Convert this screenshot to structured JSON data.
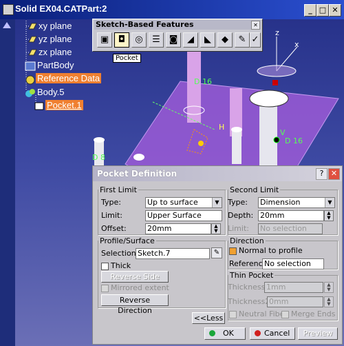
{
  "window": {
    "title": "Solid EX04.CATPart:2",
    "btn_min": "_",
    "btn_max": "□",
    "btn_close": "✕"
  },
  "tree": {
    "items": [
      {
        "label": "xy plane"
      },
      {
        "label": "yz plane"
      },
      {
        "label": "zx plane"
      },
      {
        "label": "PartBody"
      },
      {
        "label": "Reference Data"
      },
      {
        "label": "Body.5"
      },
      {
        "label": "Pocket.1"
      }
    ]
  },
  "toolbar": {
    "title": "Sketch-Based Features",
    "tooltip": "Pocket",
    "close": "✕"
  },
  "viewport": {
    "label_d16_a": "D 16",
    "label_d16_b": "D 16",
    "label_d8": "D 8",
    "label_h": "H",
    "label_v": "V",
    "label_z": "z",
    "label_x": "x"
  },
  "dialog": {
    "title": "Pocket Definition",
    "help": "?",
    "close": "✕",
    "first_limit": {
      "legend": "First Limit",
      "type_label": "Type:",
      "type_value": "Up to surface",
      "limit_label": "Limit:",
      "limit_value": "Upper Surface",
      "offset_label": "Offset:",
      "offset_value": "20mm"
    },
    "second_limit": {
      "legend": "Second Limit",
      "type_label": "Type:",
      "type_value": "Dimension",
      "depth_label": "Depth:",
      "depth_value": "20mm",
      "limit_label": "Limit:",
      "limit_value": "No selection"
    },
    "profile": {
      "legend": "Profile/Surface",
      "selection_label": "Selection:",
      "selection_value": "Sketch.7",
      "thick_label": "Thick",
      "reverse_side": "Reverse Side",
      "mirrored_extent": "Mirrored extent",
      "reverse_direction": "Reverse Direction"
    },
    "direction": {
      "legend": "Direction",
      "normal_label": "Normal to profile",
      "reference_label": "Reference:",
      "reference_value": "No selection"
    },
    "thin_pocket": {
      "legend": "Thin Pocket",
      "thickness1_label": "Thickness1:",
      "thickness1_value": "1mm",
      "thickness2_label": "Thickness2:",
      "thickness2_value": "0mm",
      "neutral_fiber": "Neutral Fiber",
      "merge_ends": "Merge Ends"
    },
    "less_button": "<<Less",
    "ok_button": "OK",
    "cancel_button": "Cancel",
    "preview_button": "Preview"
  }
}
